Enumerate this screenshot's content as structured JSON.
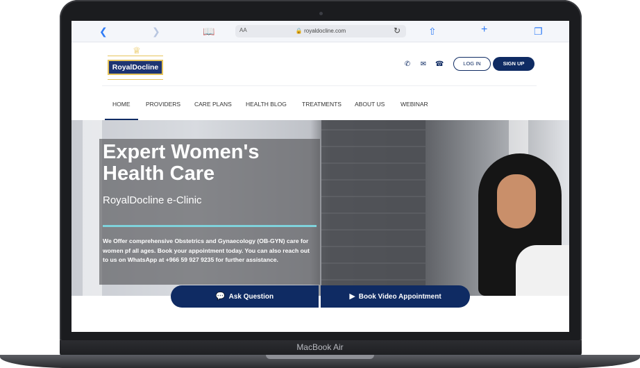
{
  "device": {
    "label": "MacBook Air"
  },
  "browser": {
    "text_size_label": "AA",
    "url": "royaldocline.com"
  },
  "brand": {
    "logo_text": "RoyalDocline",
    "colors": {
      "primary": "#0f2b63",
      "gold": "#e6c45a",
      "accent": "#7fd3dc"
    }
  },
  "header": {
    "contact_icons": [
      "whatsapp-icon",
      "mail-icon",
      "phone-icon"
    ],
    "login_label": "LOG IN",
    "signup_label": "SIGN UP"
  },
  "nav": {
    "items": [
      "HOME",
      "PROVIDERS",
      "CARE PLANS",
      "HEALTH BLOG",
      "TREATMENTS",
      "ABOUT US",
      "WEBINAR"
    ],
    "active": "HOME"
  },
  "hero": {
    "title": "Expert Women's Health Care",
    "subtitle": "RoyalDocline e-Clinic",
    "description": "We Offer comprehensive Obstetrics and Gynaecology (OB-GYN) care for women pf all ages. Book your appointment today.  You can also reach out to us on WhatsApp at +966 59 927 9235 for further assistance."
  },
  "cta": {
    "ask_label": "Ask Question",
    "book_label": "Book Video Appointment"
  }
}
